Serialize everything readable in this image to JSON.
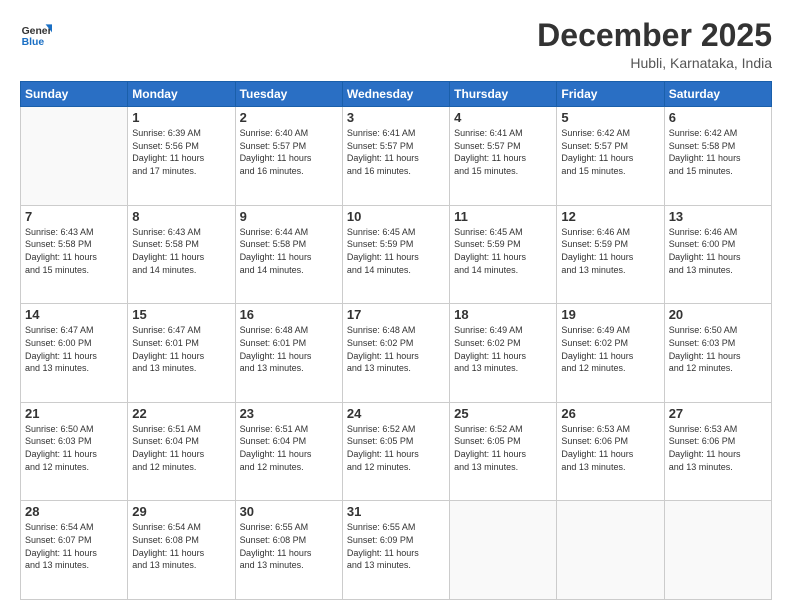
{
  "header": {
    "logo_line1": "General",
    "logo_line2": "Blue",
    "month": "December 2025",
    "location": "Hubli, Karnataka, India"
  },
  "days_of_week": [
    "Sunday",
    "Monday",
    "Tuesday",
    "Wednesday",
    "Thursday",
    "Friday",
    "Saturday"
  ],
  "weeks": [
    [
      {
        "day": "",
        "info": ""
      },
      {
        "day": "1",
        "info": "Sunrise: 6:39 AM\nSunset: 5:56 PM\nDaylight: 11 hours\nand 17 minutes."
      },
      {
        "day": "2",
        "info": "Sunrise: 6:40 AM\nSunset: 5:57 PM\nDaylight: 11 hours\nand 16 minutes."
      },
      {
        "day": "3",
        "info": "Sunrise: 6:41 AM\nSunset: 5:57 PM\nDaylight: 11 hours\nand 16 minutes."
      },
      {
        "day": "4",
        "info": "Sunrise: 6:41 AM\nSunset: 5:57 PM\nDaylight: 11 hours\nand 15 minutes."
      },
      {
        "day": "5",
        "info": "Sunrise: 6:42 AM\nSunset: 5:57 PM\nDaylight: 11 hours\nand 15 minutes."
      },
      {
        "day": "6",
        "info": "Sunrise: 6:42 AM\nSunset: 5:58 PM\nDaylight: 11 hours\nand 15 minutes."
      }
    ],
    [
      {
        "day": "7",
        "info": "Sunrise: 6:43 AM\nSunset: 5:58 PM\nDaylight: 11 hours\nand 15 minutes."
      },
      {
        "day": "8",
        "info": "Sunrise: 6:43 AM\nSunset: 5:58 PM\nDaylight: 11 hours\nand 14 minutes."
      },
      {
        "day": "9",
        "info": "Sunrise: 6:44 AM\nSunset: 5:58 PM\nDaylight: 11 hours\nand 14 minutes."
      },
      {
        "day": "10",
        "info": "Sunrise: 6:45 AM\nSunset: 5:59 PM\nDaylight: 11 hours\nand 14 minutes."
      },
      {
        "day": "11",
        "info": "Sunrise: 6:45 AM\nSunset: 5:59 PM\nDaylight: 11 hours\nand 14 minutes."
      },
      {
        "day": "12",
        "info": "Sunrise: 6:46 AM\nSunset: 5:59 PM\nDaylight: 11 hours\nand 13 minutes."
      },
      {
        "day": "13",
        "info": "Sunrise: 6:46 AM\nSunset: 6:00 PM\nDaylight: 11 hours\nand 13 minutes."
      }
    ],
    [
      {
        "day": "14",
        "info": "Sunrise: 6:47 AM\nSunset: 6:00 PM\nDaylight: 11 hours\nand 13 minutes."
      },
      {
        "day": "15",
        "info": "Sunrise: 6:47 AM\nSunset: 6:01 PM\nDaylight: 11 hours\nand 13 minutes."
      },
      {
        "day": "16",
        "info": "Sunrise: 6:48 AM\nSunset: 6:01 PM\nDaylight: 11 hours\nand 13 minutes."
      },
      {
        "day": "17",
        "info": "Sunrise: 6:48 AM\nSunset: 6:02 PM\nDaylight: 11 hours\nand 13 minutes."
      },
      {
        "day": "18",
        "info": "Sunrise: 6:49 AM\nSunset: 6:02 PM\nDaylight: 11 hours\nand 13 minutes."
      },
      {
        "day": "19",
        "info": "Sunrise: 6:49 AM\nSunset: 6:02 PM\nDaylight: 11 hours\nand 12 minutes."
      },
      {
        "day": "20",
        "info": "Sunrise: 6:50 AM\nSunset: 6:03 PM\nDaylight: 11 hours\nand 12 minutes."
      }
    ],
    [
      {
        "day": "21",
        "info": "Sunrise: 6:50 AM\nSunset: 6:03 PM\nDaylight: 11 hours\nand 12 minutes."
      },
      {
        "day": "22",
        "info": "Sunrise: 6:51 AM\nSunset: 6:04 PM\nDaylight: 11 hours\nand 12 minutes."
      },
      {
        "day": "23",
        "info": "Sunrise: 6:51 AM\nSunset: 6:04 PM\nDaylight: 11 hours\nand 12 minutes."
      },
      {
        "day": "24",
        "info": "Sunrise: 6:52 AM\nSunset: 6:05 PM\nDaylight: 11 hours\nand 12 minutes."
      },
      {
        "day": "25",
        "info": "Sunrise: 6:52 AM\nSunset: 6:05 PM\nDaylight: 11 hours\nand 13 minutes."
      },
      {
        "day": "26",
        "info": "Sunrise: 6:53 AM\nSunset: 6:06 PM\nDaylight: 11 hours\nand 13 minutes."
      },
      {
        "day": "27",
        "info": "Sunrise: 6:53 AM\nSunset: 6:06 PM\nDaylight: 11 hours\nand 13 minutes."
      }
    ],
    [
      {
        "day": "28",
        "info": "Sunrise: 6:54 AM\nSunset: 6:07 PM\nDaylight: 11 hours\nand 13 minutes."
      },
      {
        "day": "29",
        "info": "Sunrise: 6:54 AM\nSunset: 6:08 PM\nDaylight: 11 hours\nand 13 minutes."
      },
      {
        "day": "30",
        "info": "Sunrise: 6:55 AM\nSunset: 6:08 PM\nDaylight: 11 hours\nand 13 minutes."
      },
      {
        "day": "31",
        "info": "Sunrise: 6:55 AM\nSunset: 6:09 PM\nDaylight: 11 hours\nand 13 minutes."
      },
      {
        "day": "",
        "info": ""
      },
      {
        "day": "",
        "info": ""
      },
      {
        "day": "",
        "info": ""
      }
    ]
  ]
}
